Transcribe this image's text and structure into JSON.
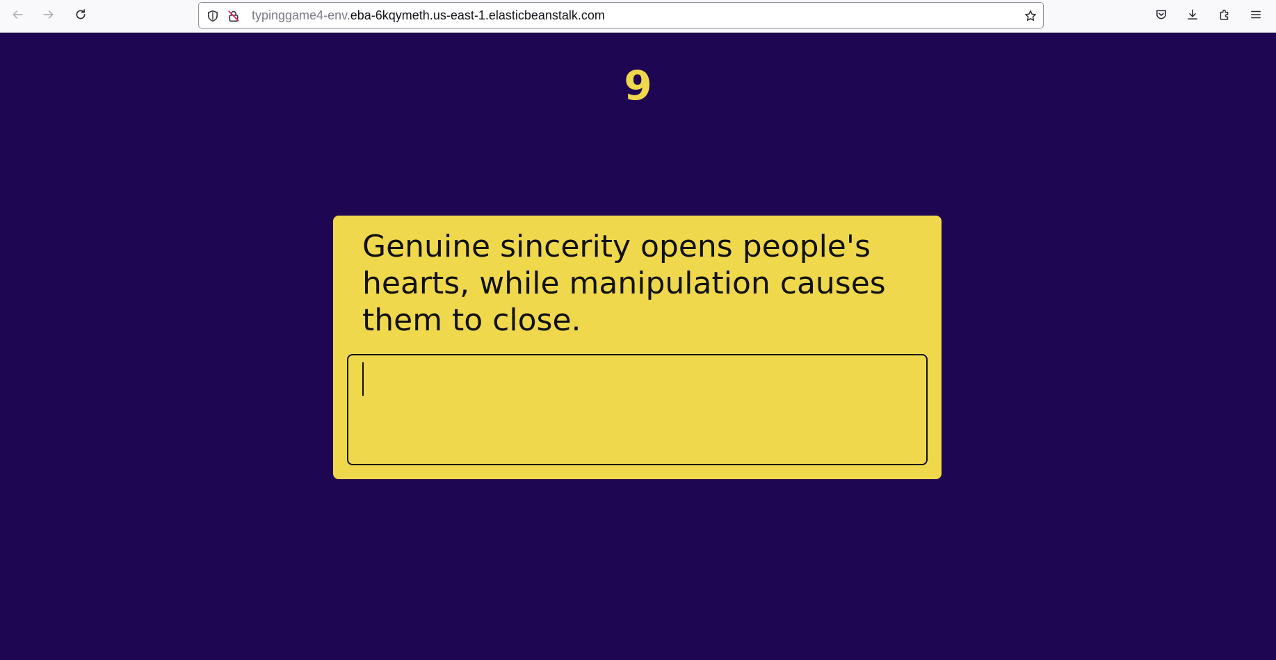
{
  "browser": {
    "url": {
      "subdomain": "typinggame4-env.",
      "domain": "eba-6kqymeth.us-east-1.elasticbeanstalk.com"
    },
    "icons": {
      "back": "back-arrow-icon",
      "forward": "forward-arrow-icon",
      "reload": "reload-icon",
      "tracking": "shield-icon",
      "insecure": "insecure-lock-icon",
      "bookmark": "star-icon",
      "pocket": "pocket-icon",
      "downloads": "download-icon",
      "extensions": "puzzle-icon",
      "menu": "hamburger-menu-icon"
    }
  },
  "game": {
    "timer": "9",
    "prompt": "Genuine sincerity opens people's hearts, while manipulation causes them to close.",
    "input_value": ""
  },
  "colors": {
    "background": "#1f0652",
    "accent": "#f0d84d",
    "text": "#111111"
  }
}
